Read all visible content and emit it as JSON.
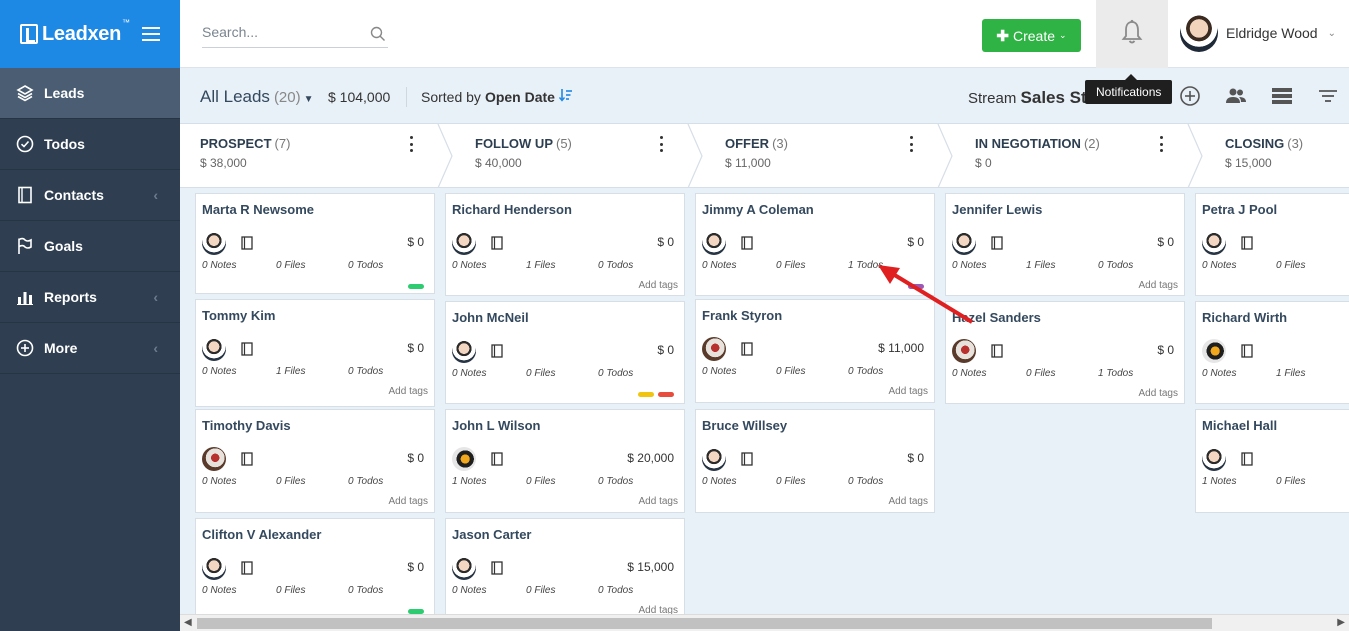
{
  "brand": {
    "name": "Leadxen",
    "tm": "™"
  },
  "sidebar": {
    "items": [
      {
        "label": "Leads",
        "icon": "layers-icon",
        "active": true
      },
      {
        "label": "Todos",
        "icon": "check-circle-icon"
      },
      {
        "label": "Contacts",
        "icon": "address-book-icon",
        "chevron": "‹"
      },
      {
        "label": "Goals",
        "icon": "flag-icon"
      },
      {
        "label": "Reports",
        "icon": "bar-chart-icon",
        "chevron": "‹"
      },
      {
        "label": "More",
        "icon": "plus-circle-icon",
        "chevron": "‹"
      }
    ]
  },
  "topbar": {
    "search_placeholder": "Search...",
    "create_label": "Create",
    "user_name": "Eldridge Wood",
    "tooltip": "Notifications"
  },
  "subheader": {
    "title": "All Leads",
    "count": "(20)",
    "total": "$ 104,000",
    "sorted_prefix": "Sorted by",
    "sorted_field": "Open Date",
    "stream_prefix": "Stream",
    "stream_name": "Sales Stream"
  },
  "stages": [
    {
      "name": "PROSPECT",
      "count": "(7)",
      "amount": "$ 38,000"
    },
    {
      "name": "FOLLOW UP",
      "count": "(5)",
      "amount": "$ 40,000"
    },
    {
      "name": "OFFER",
      "count": "(3)",
      "amount": "$ 11,000"
    },
    {
      "name": "IN NEGOTIATION",
      "count": "(2)",
      "amount": "$ 0"
    },
    {
      "name": "CLOSING",
      "count": "(3)",
      "amount": "$ 15,000"
    }
  ],
  "columns": [
    [
      {
        "name": "Marta R Newsome",
        "avatar": "man",
        "amount": "$ 0",
        "notes": "0 Notes",
        "files": "0 Files",
        "todos": "0 Todos",
        "add_tags": "",
        "tags": [
          "#2ecc71"
        ]
      },
      {
        "name": "Tommy Kim",
        "avatar": "man",
        "amount": "$ 0",
        "notes": "0 Notes",
        "files": "1 Files",
        "todos": "0 Todos",
        "add_tags": "Add tags",
        "tags": []
      },
      {
        "name": "Timothy Davis",
        "avatar": "bird",
        "amount": "$ 0",
        "notes": "0 Notes",
        "files": "0 Files",
        "todos": "0 Todos",
        "add_tags": "Add tags",
        "tags": []
      },
      {
        "name": "Clifton V Alexander",
        "avatar": "man",
        "amount": "$ 0",
        "notes": "0 Notes",
        "files": "0 Files",
        "todos": "0 Todos",
        "add_tags": "",
        "tags": [
          "#2ecc71"
        ]
      }
    ],
    [
      {
        "name": "Richard Henderson",
        "avatar": "man",
        "amount": "$ 0",
        "notes": "0 Notes",
        "files": "1 Files",
        "todos": "0 Todos",
        "add_tags": "Add tags",
        "tags": []
      },
      {
        "name": "John McNeil",
        "avatar": "man",
        "amount": "$ 0",
        "notes": "0 Notes",
        "files": "0 Files",
        "todos": "0 Todos",
        "add_tags": "",
        "tags": [
          "#f1c40f",
          "#e74c3c"
        ]
      },
      {
        "name": "John L Wilson",
        "avatar": "bee",
        "amount": "$ 20,000",
        "notes": "1 Notes",
        "files": "0 Files",
        "todos": "0 Todos",
        "add_tags": "Add tags",
        "tags": []
      },
      {
        "name": "Jason Carter",
        "avatar": "man",
        "amount": "$ 15,000",
        "notes": "0 Notes",
        "files": "0 Files",
        "todos": "0 Todos",
        "add_tags": "Add tags",
        "tags": []
      }
    ],
    [
      {
        "name": "Jimmy A Coleman",
        "avatar": "man",
        "amount": "$ 0",
        "notes": "0 Notes",
        "files": "0 Files",
        "todos": "1 Todos",
        "add_tags": "",
        "tags": [
          "#9b59b6"
        ]
      },
      {
        "name": "Frank Styron",
        "avatar": "bird",
        "amount": "$ 11,000",
        "notes": "0 Notes",
        "files": "0 Files",
        "todos": "0 Todos",
        "add_tags": "Add tags",
        "tags": []
      },
      {
        "name": "Bruce Willsey",
        "avatar": "man",
        "amount": "$ 0",
        "notes": "0 Notes",
        "files": "0 Files",
        "todos": "0 Todos",
        "add_tags": "Add tags",
        "tags": []
      }
    ],
    [
      {
        "name": "Jennifer Lewis",
        "avatar": "man",
        "amount": "$ 0",
        "notes": "0 Notes",
        "files": "1 Files",
        "todos": "0 Todos",
        "add_tags": "Add tags",
        "tags": []
      },
      {
        "name": "Hazel Sanders",
        "avatar": "bird",
        "amount": "$ 0",
        "notes": "0 Notes",
        "files": "0 Files",
        "todos": "1 Todos",
        "add_tags": "Add tags",
        "tags": []
      }
    ],
    [
      {
        "name": "Petra J Pool",
        "avatar": "man",
        "amount": "",
        "notes": "0 Notes",
        "files": "0 Files",
        "todos": "",
        "add_tags": "",
        "tags": []
      },
      {
        "name": "Richard Wirth",
        "avatar": "bee",
        "amount": "",
        "notes": "0 Notes",
        "files": "1 Files",
        "todos": "",
        "add_tags": "",
        "tags": []
      },
      {
        "name": "Michael Hall",
        "avatar": "man",
        "amount": "",
        "notes": "1 Notes",
        "files": "0 Files",
        "todos": "",
        "add_tags": "",
        "tags": []
      }
    ]
  ],
  "colors": {
    "brand": "#1e88e5",
    "sidebar": "#2f3f51",
    "create": "#2fb344",
    "annotation": "#e02020"
  }
}
